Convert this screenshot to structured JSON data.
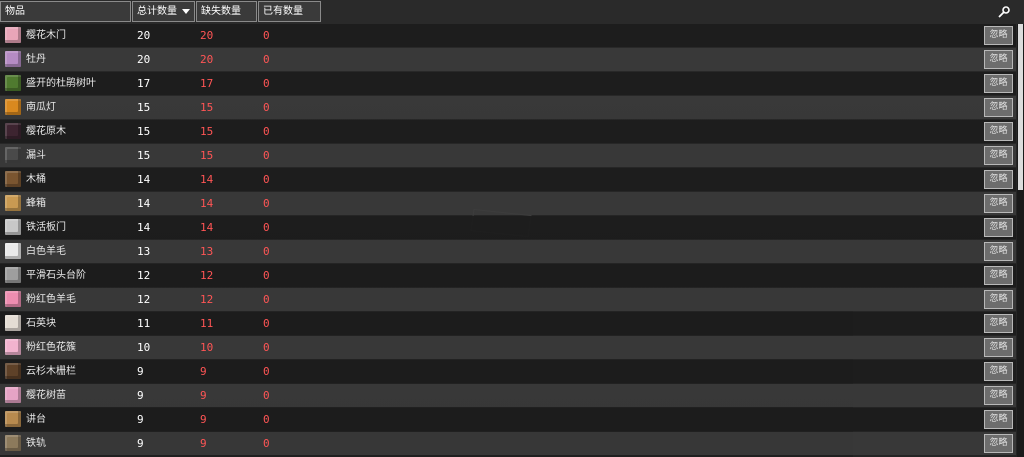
{
  "header": {
    "item_label": "物品",
    "total_label": "总计数量",
    "missing_label": "缺失数量",
    "have_label": "已有数量"
  },
  "ignore_label": "忽略",
  "colors": {
    "missing": "#ff5555",
    "have": "#ff5555",
    "total": "#ffffff"
  },
  "rows": [
    {
      "icon": "cherry-door-icon",
      "icon_color": "#e8a5b8",
      "name": "樱花木门",
      "total": "20",
      "missing": "20",
      "have": "0"
    },
    {
      "icon": "peony-icon",
      "icon_color": "#b58bc4",
      "name": "牡丹",
      "total": "20",
      "missing": "20",
      "have": "0"
    },
    {
      "icon": "flowering-azalea-leaves-icon",
      "icon_color": "#4f7a2f",
      "name": "盛开的杜鹃树叶",
      "total": "17",
      "missing": "17",
      "have": "0"
    },
    {
      "icon": "jack-o-lantern-icon",
      "icon_color": "#d9891f",
      "name": "南瓜灯",
      "total": "15",
      "missing": "15",
      "have": "0"
    },
    {
      "icon": "cherry-log-icon",
      "icon_color": "#3d2430",
      "name": "樱花原木",
      "total": "15",
      "missing": "15",
      "have": "0"
    },
    {
      "icon": "hopper-icon",
      "icon_color": "#4a4a4a",
      "name": "漏斗",
      "total": "15",
      "missing": "15",
      "have": "0"
    },
    {
      "icon": "barrel-icon",
      "icon_color": "#7a5530",
      "name": "木桶",
      "total": "14",
      "missing": "14",
      "have": "0"
    },
    {
      "icon": "beehive-icon",
      "icon_color": "#c99a52",
      "name": "蜂箱",
      "total": "14",
      "missing": "14",
      "have": "0"
    },
    {
      "icon": "iron-trapdoor-icon",
      "icon_color": "#c8c8c8",
      "name": "铁活板门",
      "total": "14",
      "missing": "14",
      "have": "0"
    },
    {
      "icon": "white-wool-icon",
      "icon_color": "#eaeaea",
      "name": "白色羊毛",
      "total": "13",
      "missing": "13",
      "have": "0"
    },
    {
      "icon": "smooth-stone-slab-icon",
      "icon_color": "#9e9e9e",
      "name": "平滑石头台阶",
      "total": "12",
      "missing": "12",
      "have": "0"
    },
    {
      "icon": "pink-wool-icon",
      "icon_color": "#ee8db0",
      "name": "粉红色羊毛",
      "total": "12",
      "missing": "12",
      "have": "0"
    },
    {
      "icon": "quartz-block-icon",
      "icon_color": "#e4ddd4",
      "name": "石英块",
      "total": "11",
      "missing": "11",
      "have": "0"
    },
    {
      "icon": "pink-petals-icon",
      "icon_color": "#f2b3cf",
      "name": "粉红色花簇",
      "total": "10",
      "missing": "10",
      "have": "0"
    },
    {
      "icon": "spruce-fence-icon",
      "icon_color": "#5e4128",
      "name": "云杉木栅栏",
      "total": "9",
      "missing": "9",
      "have": "0"
    },
    {
      "icon": "cherry-sapling-icon",
      "icon_color": "#e6a3c5",
      "name": "樱花树苗",
      "total": "9",
      "missing": "9",
      "have": "0"
    },
    {
      "icon": "lectern-icon",
      "icon_color": "#b88a4e",
      "name": "讲台",
      "total": "9",
      "missing": "9",
      "have": "0"
    },
    {
      "icon": "rail-icon",
      "icon_color": "#8c7a5c",
      "name": "铁轨",
      "total": "9",
      "missing": "9",
      "have": "0"
    }
  ]
}
